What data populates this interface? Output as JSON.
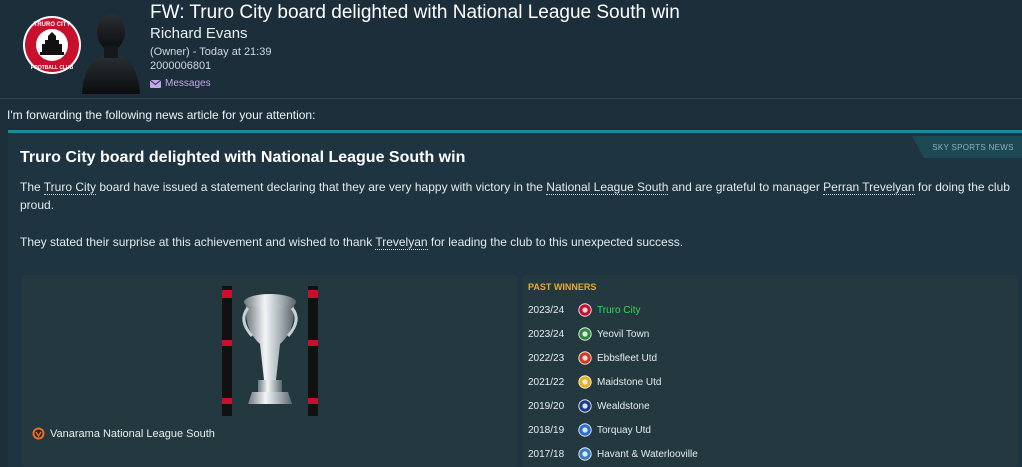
{
  "message": {
    "title": "FW: Truro City board delighted with National League South win",
    "sender": "Richard Evans",
    "sender_meta": "(Owner) - Today at 21:39",
    "sender_id": "2000006801",
    "folder_link": "Messages",
    "badge_text_top": "TRURO CITY",
    "badge_text_bottom": "FOOTBALL CLUB"
  },
  "forward_text": "I'm forwarding the following news article for your attention:",
  "article": {
    "source": "SKY SPORTS NEWS",
    "headline": "Truro City board delighted with National League South win",
    "p1": {
      "a": "The ",
      "club": "Truro City",
      "b": " board have issued a statement declaring that they are very happy with victory in the ",
      "league": "National League South",
      "c": " and are grateful to manager ",
      "manager": "Perran Trevelyan",
      "d": " for doing the club proud."
    },
    "p2": {
      "a": "They stated their surprise at this achievement and wished to thank ",
      "manager": "Trevelyan",
      "b": " for leading the club to this unexpected success."
    }
  },
  "competition": {
    "name": "Vanarama National League South"
  },
  "past_winners": {
    "title": "PAST WINNERS",
    "rows": [
      {
        "season": "2023/24",
        "team": "Truro City",
        "color": "#c8102e",
        "highlight": true
      },
      {
        "season": "2023/24",
        "team": "Yeovil Town",
        "color": "#2e8b3e",
        "highlight": false
      },
      {
        "season": "2022/23",
        "team": "Ebbsfleet Utd",
        "color": "#d23a1e",
        "highlight": false
      },
      {
        "season": "2021/22",
        "team": "Maidstone Utd",
        "color": "#e5b01c",
        "highlight": false
      },
      {
        "season": "2019/20",
        "team": "Wealdstone",
        "color": "#1d3f8a",
        "highlight": false
      },
      {
        "season": "2018/19",
        "team": "Torquay Utd",
        "color": "#2a6fd0",
        "highlight": false
      },
      {
        "season": "2017/18",
        "team": "Havant & Waterlooville",
        "color": "#3a7fc4",
        "highlight": false
      }
    ]
  },
  "colors": {
    "accent": "#1e8a96",
    "highlight": "#34d856",
    "winners_title": "#e8a838"
  }
}
